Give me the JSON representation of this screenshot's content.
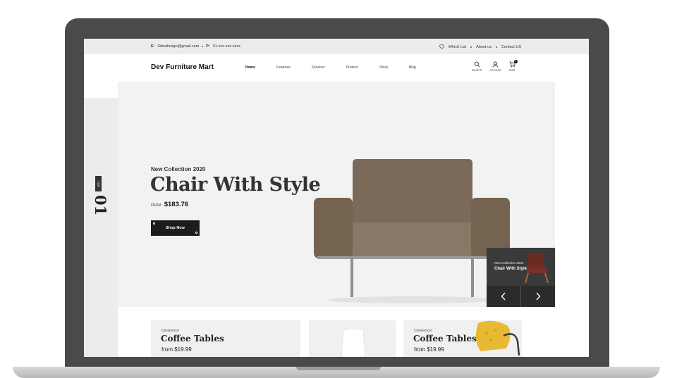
{
  "topbar": {
    "email_prefix": "E:",
    "email": "0devdesign@gmail.com",
    "phone_prefix": "P:",
    "phone": "01-xxx-xxx-xxxx",
    "wishlist": "Which List",
    "about": "About us",
    "contact": "Contact US"
  },
  "header": {
    "logo": "Dev Furniture Mart",
    "nav": [
      "Home",
      "Features",
      "Services",
      "Product",
      "Shop",
      "Blog"
    ],
    "active_nav": "Home",
    "icons": [
      {
        "icon": "search-icon",
        "label": "Search"
      },
      {
        "icon": "account-icon",
        "label": "Account"
      },
      {
        "icon": "cart-icon",
        "label": "Cart"
      }
    ],
    "cart_count": "0"
  },
  "side": {
    "slide_tag": "TOP",
    "slide_number": "01"
  },
  "hero": {
    "kicker": "New Collection 2020",
    "title": "Chair With Style",
    "price_prefix": "FROM",
    "price": "$183.76",
    "cta": "Shop Now",
    "preview_kicker": "New Collection 2020",
    "preview_title": "Chair With Style"
  },
  "cards": [
    {
      "label": "Clearence",
      "name": "Coffee Tables",
      "price": "from $19.99"
    },
    {
      "label": "",
      "name": "",
      "price": ""
    },
    {
      "label": "Clearence",
      "name": "Coffee Tables",
      "price": "from $19.99"
    }
  ],
  "colors": {
    "dark": "#1c1c1c",
    "hero_bg": "#f2f2f2",
    "chair": "#7a6a5a",
    "accent_yellow": "#e8b932"
  }
}
